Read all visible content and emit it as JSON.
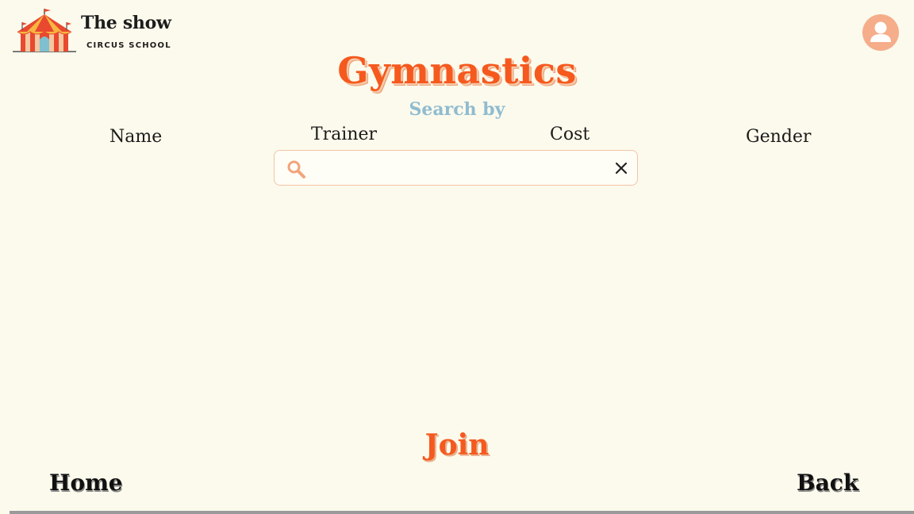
{
  "header": {
    "logo_icon": "circus-tent-icon",
    "brand_title": "The show",
    "brand_subtitle": "CIRCUS SCHOOL",
    "avatar_icon": "user-icon",
    "avatar_color": "#f5ad8a"
  },
  "main": {
    "title": "Gymnastics",
    "search_by_label": "Search by",
    "filters": [
      "Name",
      "Trainer",
      "Cost",
      "Gender"
    ],
    "search": {
      "value": "",
      "placeholder": "",
      "search_icon": "search-icon",
      "clear_icon": "close-icon"
    },
    "join_label": "Join"
  },
  "footer": {
    "home_label": "Home",
    "back_label": "Back"
  },
  "colors": {
    "background": "#fcfaec",
    "accent": "#f5591e",
    "subtitle": "#8fbcd0",
    "search_border": "#f4c3a4"
  }
}
